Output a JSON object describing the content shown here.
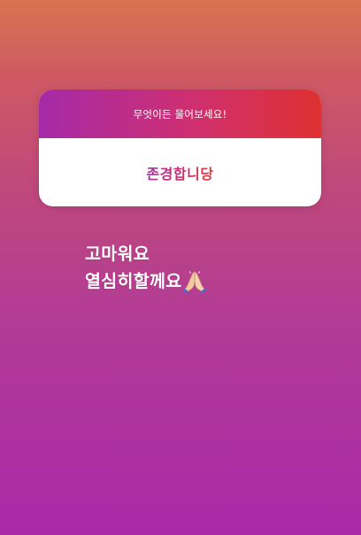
{
  "question_sticker": {
    "prompt": "무엇이든 물어보세요!",
    "answer": "존경합니당"
  },
  "caption": {
    "line1": "고마워요",
    "line2": "열심히할께요",
    "emoji": "folded-hands-icon"
  },
  "colors": {
    "background_top": "#d9734f",
    "background_bottom": "#a82aa8",
    "sticker_header_start": "#a52aa8",
    "sticker_header_end": "#df3131",
    "answer_text": "#c92f73"
  }
}
